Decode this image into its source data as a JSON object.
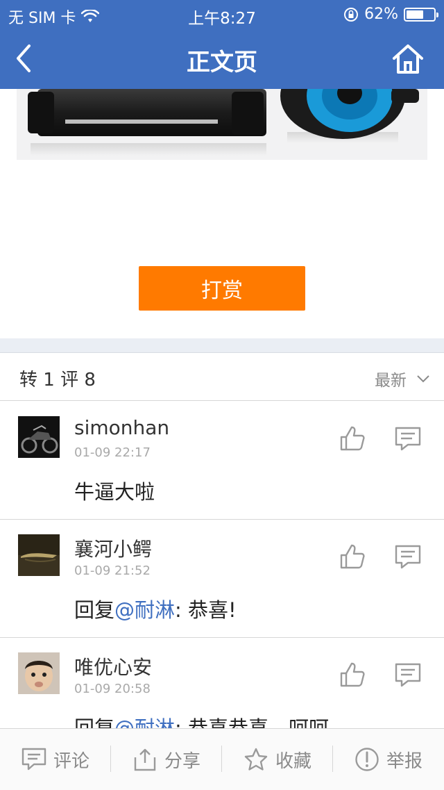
{
  "status_bar": {
    "carrier": "无 SIM 卡",
    "time": "上午8:27",
    "battery": "62%",
    "battery_level": 0.62
  },
  "nav": {
    "title": "正文页",
    "back_icon": "chevron-left-icon",
    "home_icon": "home-icon"
  },
  "reward_button": "打赏",
  "comments_header": {
    "counts": "转 1 评 8",
    "sort": "最新"
  },
  "comments": [
    {
      "user": "simonhan",
      "date": "01-09 22:17",
      "text_prefix": "",
      "mention": "",
      "text": "牛逼大啦"
    },
    {
      "user": "襄河小鳄",
      "date": "01-09 21:52",
      "text_prefix": "回复",
      "mention": "@耐淋",
      "text": ": 恭喜!"
    },
    {
      "user": "唯优心安",
      "date": "01-09 20:58",
      "text_prefix": "回复",
      "mention": "@耐淋",
      "text": ": 恭喜恭喜，呵呵"
    }
  ],
  "bottom_bar": {
    "comment": "评论",
    "share": "分享",
    "favorite": "收藏",
    "report": "举报"
  },
  "colors": {
    "header_blue": "#3f6fc0",
    "reward_orange": "#ff7a00",
    "mention_blue": "#3f6fc0"
  }
}
